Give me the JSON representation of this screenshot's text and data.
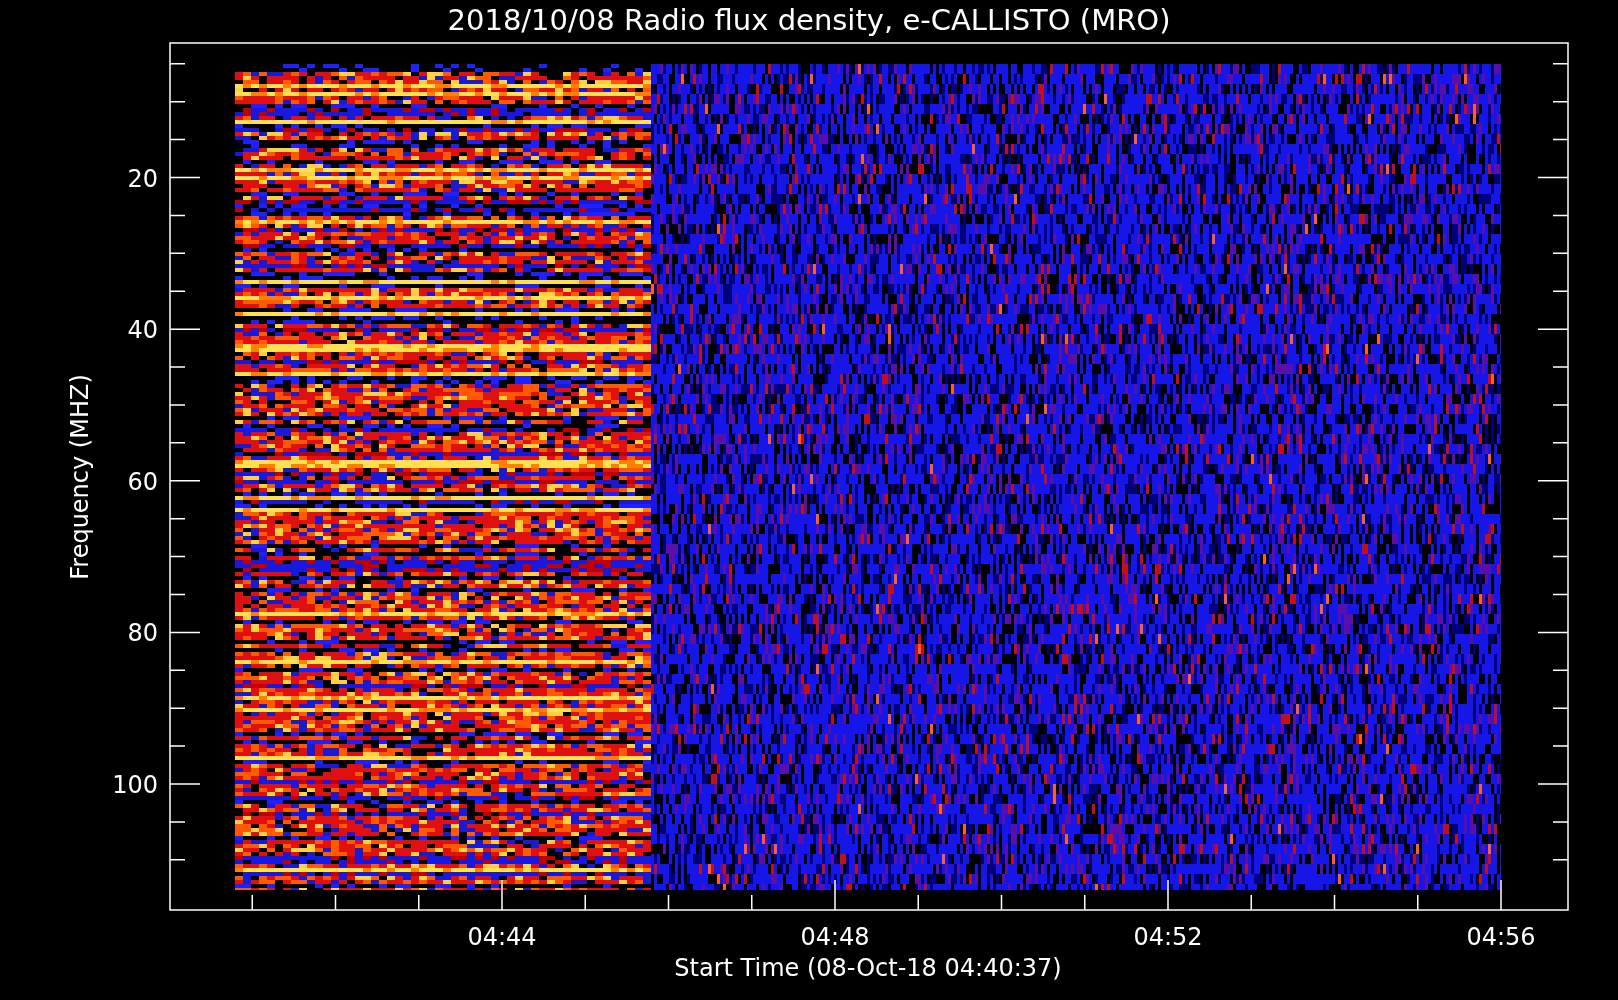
{
  "title": "2018/10/08  Radio flux density, e-CALLISTO (MRO)",
  "y_axis": {
    "label": "Frequency (MHZ)",
    "tick_labels": [
      "20",
      "40",
      "60",
      "80",
      "100"
    ]
  },
  "x_axis": {
    "label": "Start Time (08-Oct-18 04:40:37)",
    "tick_labels": [
      "04:44",
      "04:48",
      "04:52",
      "04:56"
    ]
  }
}
